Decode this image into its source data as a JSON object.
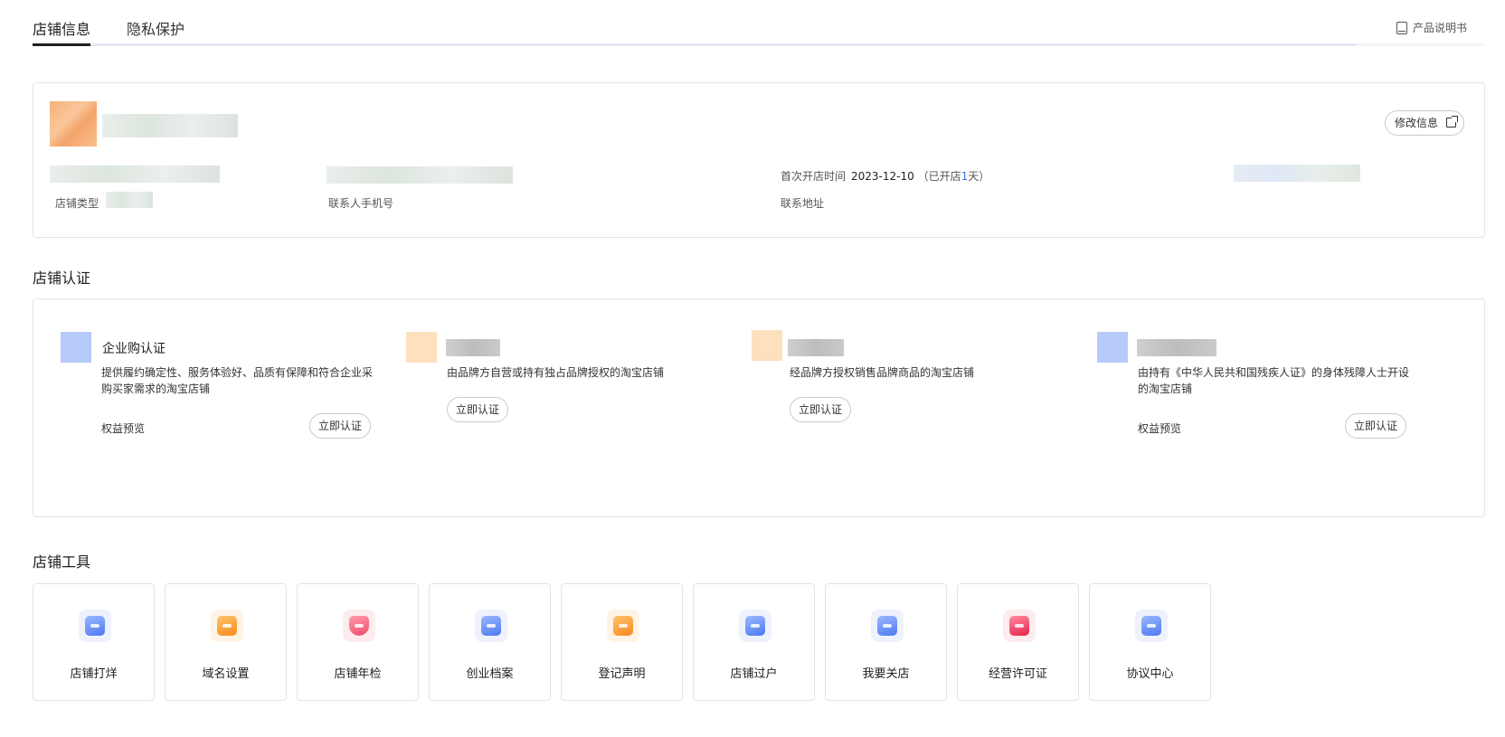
{
  "tabs": [
    {
      "label": "店铺信息",
      "active": true
    },
    {
      "label": "隐私保护",
      "active": false
    }
  ],
  "manual_label": "产品说明书",
  "shop_info": {
    "edit_label": "修改信息",
    "first_open_label": "首次开店时间",
    "first_open_date": "2023-12-10",
    "opened_prefix": "（已开店",
    "opened_days": "1",
    "opened_suffix": "天）",
    "shop_type_label": "店铺类型",
    "contact_phone_label": "联系人手机号",
    "contact_address_label": "联系地址"
  },
  "certification": {
    "section_title": "店铺认证",
    "items": [
      {
        "title": "企业购认证",
        "desc": "提供履约确定性、服务体验好、品质有保障和符合企业采购买家需求的淘宝店铺",
        "benefit_label": "权益预览",
        "button_label": "立即认证"
      },
      {
        "title": "",
        "desc": "由品牌方自营或持有独占品牌授权的淘宝店铺",
        "benefit_label": "",
        "button_label": "立即认证"
      },
      {
        "title": "",
        "desc": "经品牌方授权销售品牌商品的淘宝店铺",
        "benefit_label": "",
        "button_label": "立即认证"
      },
      {
        "title": "",
        "desc": "由持有《中华人民共和国残疾人证》的身体残障人士开设的淘宝店铺",
        "benefit_label": "权益预览",
        "button_label": "立即认证"
      }
    ]
  },
  "tools": {
    "section_title": "店铺工具",
    "items": [
      {
        "label": "店铺打烊",
        "icon": "shop-close-icon",
        "color": "#4c79f0"
      },
      {
        "label": "域名设置",
        "icon": "domain-icon",
        "color": "#f78a1e"
      },
      {
        "label": "店铺年检",
        "icon": "shield-search-icon",
        "color": "#f04a6a"
      },
      {
        "label": "创业档案",
        "icon": "archive-icon",
        "color": "#4c79f0"
      },
      {
        "label": "登记声明",
        "icon": "register-icon",
        "color": "#f78a1e"
      },
      {
        "label": "店铺过户",
        "icon": "transfer-icon",
        "color": "#4c79f0"
      },
      {
        "label": "我要关店",
        "icon": "close-shop-card-icon",
        "color": "#4c79f0"
      },
      {
        "label": "经营许可证",
        "icon": "license-folder-icon",
        "color": "#e8244c"
      },
      {
        "label": "协议中心",
        "icon": "agreement-icon",
        "color": "#4c79f0"
      }
    ]
  }
}
